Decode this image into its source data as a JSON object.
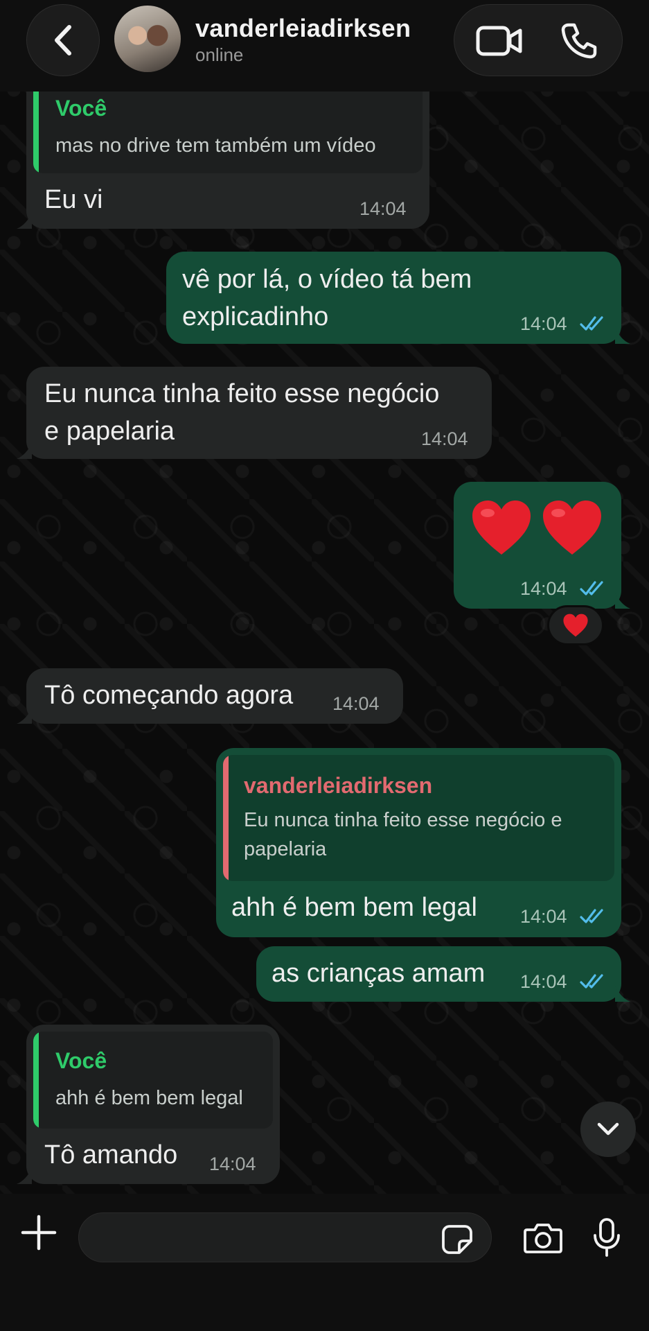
{
  "header": {
    "contact_name": "vanderleiadirksen",
    "status": "online",
    "icons": {
      "back": "chevron-left-icon",
      "avatar": "contact-photo",
      "video": "video-camera-icon",
      "phone": "phone-icon"
    }
  },
  "messages": [
    {
      "direction": "in",
      "quote_author": "Você",
      "quote_text": "mas no drive tem também um vídeo",
      "text": "Eu vi",
      "time": "14:04"
    },
    {
      "direction": "out",
      "lines": [
        "vê por lá, o vídeo tá bem",
        "explicadinho"
      ],
      "time": "14:04",
      "status": "read"
    },
    {
      "direction": "in",
      "lines": [
        "Eu nunca tinha feito esse negócio",
        "e papelaria"
      ],
      "time": "14:04"
    },
    {
      "direction": "out",
      "emoji": "❤️ ❤️",
      "time": "14:04",
      "status": "read",
      "reaction": "❤️"
    },
    {
      "direction": "in",
      "text": "Tô começando agora",
      "time": "14:04"
    },
    {
      "direction": "out",
      "quote_author": "vanderleiadirksen",
      "quote_lines": [
        "Eu nunca tinha feito esse negócio e",
        "papelaria"
      ],
      "text": "ahh é bem bem legal",
      "time": "14:04",
      "status": "read"
    },
    {
      "direction": "out",
      "text": "as crianças amam",
      "time": "14:04",
      "status": "read"
    },
    {
      "direction": "in",
      "quote_author": "Você",
      "quote_text": "ahh é bem bem legal",
      "text": "Tô amando",
      "time": "14:04"
    }
  ],
  "composer": {
    "value": "",
    "icons": {
      "plus": "plus-icon",
      "sticker": "sticker-icon",
      "camera": "camera-icon",
      "mic": "microphone-icon",
      "scroll": "chevron-down-icon"
    }
  },
  "colors": {
    "background": "#0b0b0b",
    "incoming_bubble": "#242626",
    "outgoing_bubble": "#144d37",
    "self_quote_accent": "#2fcb6a",
    "contact_quote_accent": "#e26a70",
    "read_ticks": "#53bdeb"
  }
}
